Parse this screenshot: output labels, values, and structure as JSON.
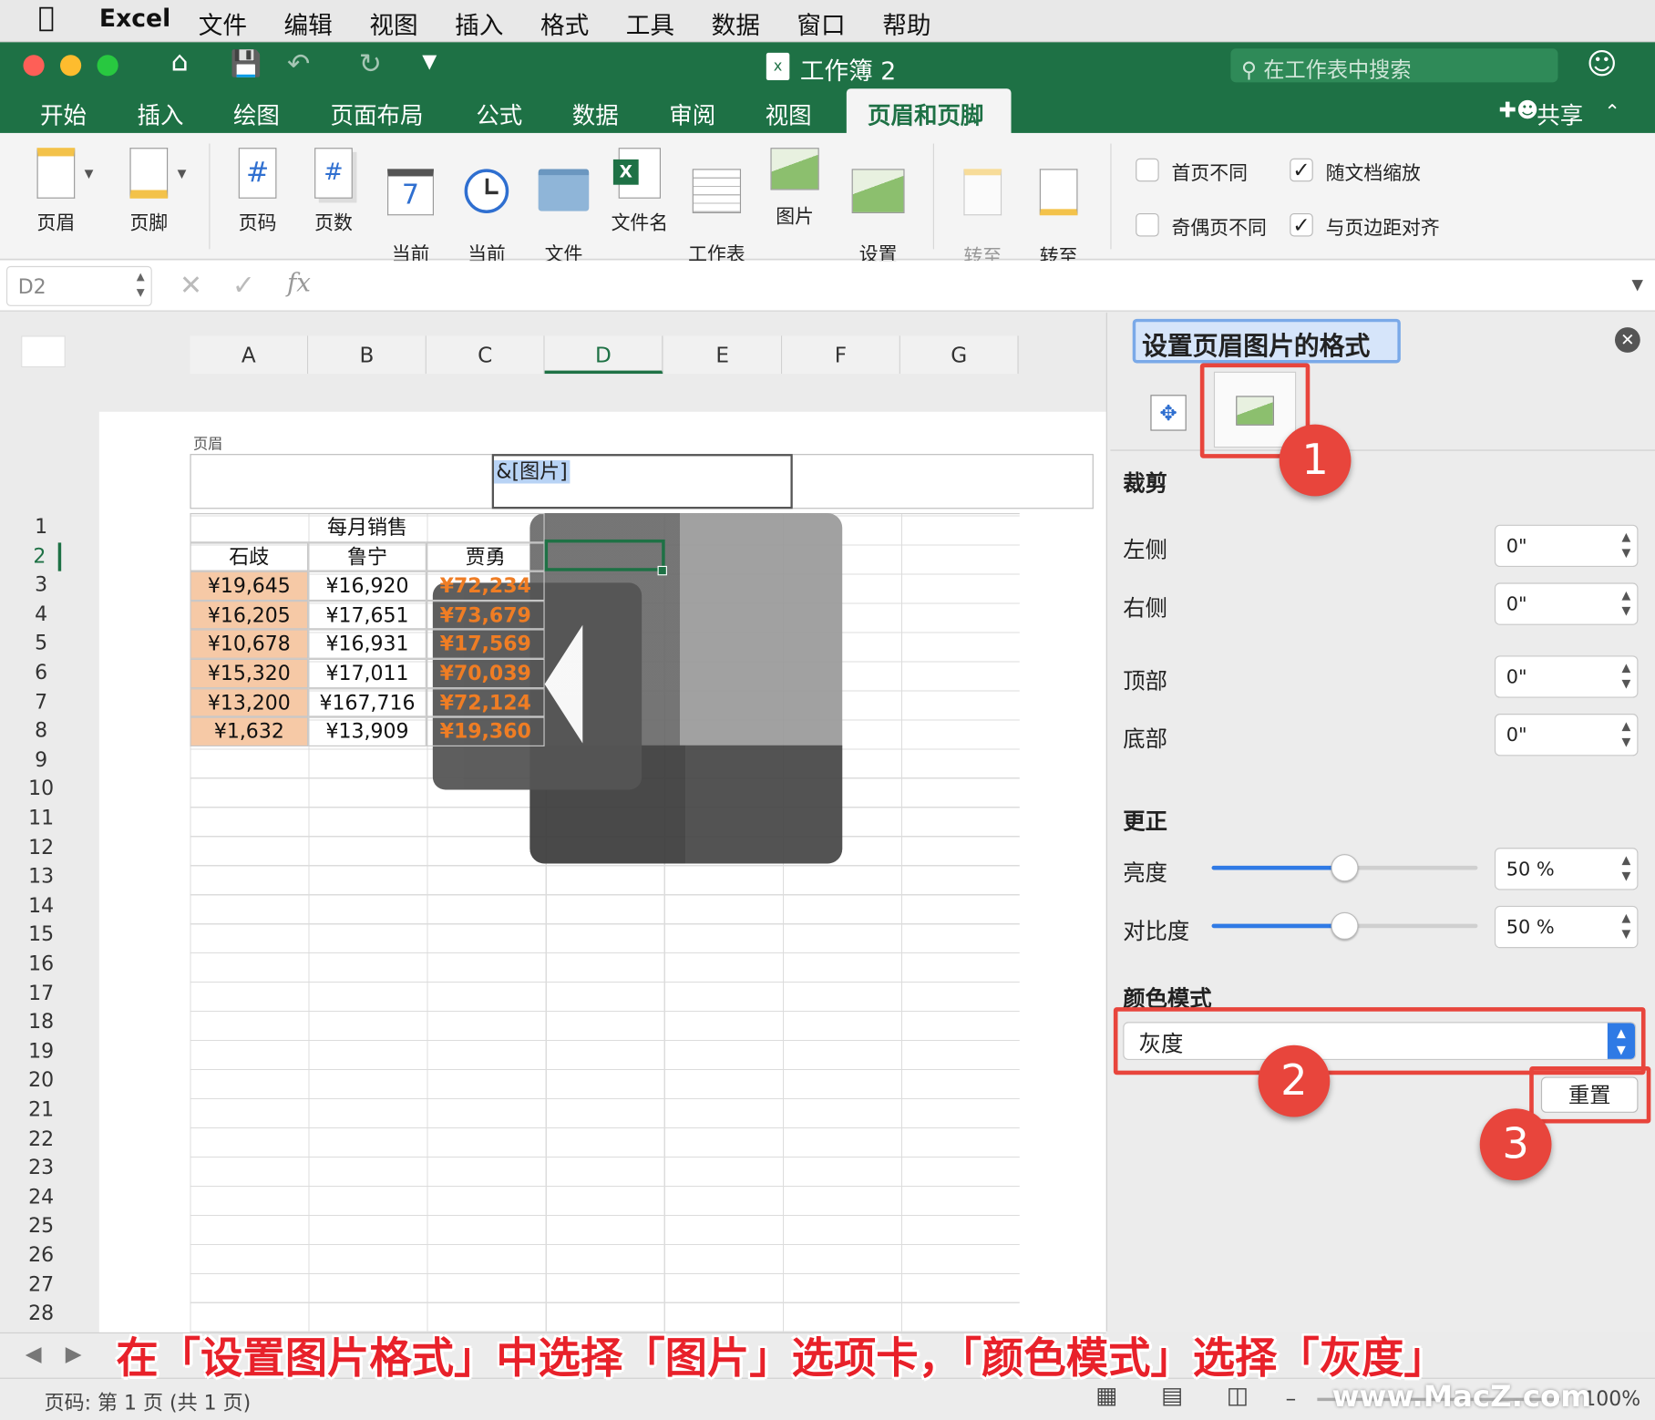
{
  "menubar": {
    "app": "Excel",
    "items": [
      "文件",
      "编辑",
      "视图",
      "插入",
      "格式",
      "工具",
      "数据",
      "窗口",
      "帮助"
    ]
  },
  "window": {
    "title": "工作簿 2",
    "search_placeholder": "在工作表中搜索",
    "share": "共享"
  },
  "tabs": [
    "开始",
    "插入",
    "绘图",
    "页面布局",
    "公式",
    "数据",
    "审阅",
    "视图",
    "页眉和页脚"
  ],
  "ribbon": {
    "header": "页眉",
    "footer": "页脚",
    "page_number": "页码",
    "page_count": "页数",
    "current_date": "当前\n日期",
    "current_time": "当前\n时间",
    "file_path": "文件\n路径",
    "file_name": "文件名",
    "sheet_name": "工作表\n名称",
    "picture": "图片",
    "format_picture": "设置\n图片格式",
    "goto_header": "转至\n页眉",
    "goto_footer": "转至\n页脚",
    "date_icon_number": "7",
    "opt_first_page": "首页不同",
    "opt_odd_even": "奇偶页不同",
    "opt_scale_doc": "随文档缩放",
    "opt_align_margins": "与页边距对齐"
  },
  "formula_bar": {
    "name_box": "D2",
    "fx": "fx"
  },
  "sheet": {
    "columns": [
      "A",
      "B",
      "C",
      "D",
      "E",
      "F",
      "G"
    ],
    "header_label": "页眉",
    "header_field": "&[图片]",
    "table_title": "每月销售",
    "names": [
      "石歧",
      "鲁宁",
      "贾勇"
    ],
    "rows": [
      [
        "¥19,645",
        "¥16,920",
        "¥72,234"
      ],
      [
        "¥16,205",
        "¥17,651",
        "¥73,679"
      ],
      [
        "¥10,678",
        "¥16,931",
        "¥17,569"
      ],
      [
        "¥15,320",
        "¥17,011",
        "¥70,039"
      ],
      [
        "¥13,200",
        "¥167,716",
        "¥72,124"
      ],
      [
        "¥1,632",
        "¥13,909",
        "¥19,360"
      ]
    ],
    "row_numbers": [
      "1",
      "2",
      "3",
      "4",
      "5",
      "6",
      "7",
      "8",
      "9",
      "10",
      "11",
      "12",
      "13",
      "14",
      "15",
      "16",
      "17",
      "18",
      "19",
      "20",
      "21",
      "22",
      "23",
      "24",
      "25",
      "26",
      "27",
      "28"
    ]
  },
  "panel": {
    "title": "设置页眉图片的格式",
    "crop": "裁剪",
    "left": "左侧",
    "right": "右侧",
    "top": "顶部",
    "bottom": "底部",
    "crop_values": [
      "0\"",
      "0\"",
      "0\"",
      "0\""
    ],
    "correct": "更正",
    "brightness": "亮度",
    "brightness_value": "50 %",
    "brightness_level": 0.5,
    "contrast": "对比度",
    "contrast_value": "50 %",
    "contrast_level": 0.5,
    "color_mode": "颜色模式",
    "color_mode_value": "灰度",
    "reset": "重置"
  },
  "badges": [
    "1",
    "2",
    "3"
  ],
  "caption": "在「设置图片格式」中选择「图片」选项卡，「颜色模式」选择「灰度」",
  "status": {
    "page_info": "页码: 第 1 页 (共 1 页)",
    "zoom": "100%"
  },
  "watermark": "www.MacZ.com",
  "colors": {
    "accent_green": "#1e7145",
    "highlight_red": "#e8453c",
    "value_orange": "#ef7d24"
  }
}
